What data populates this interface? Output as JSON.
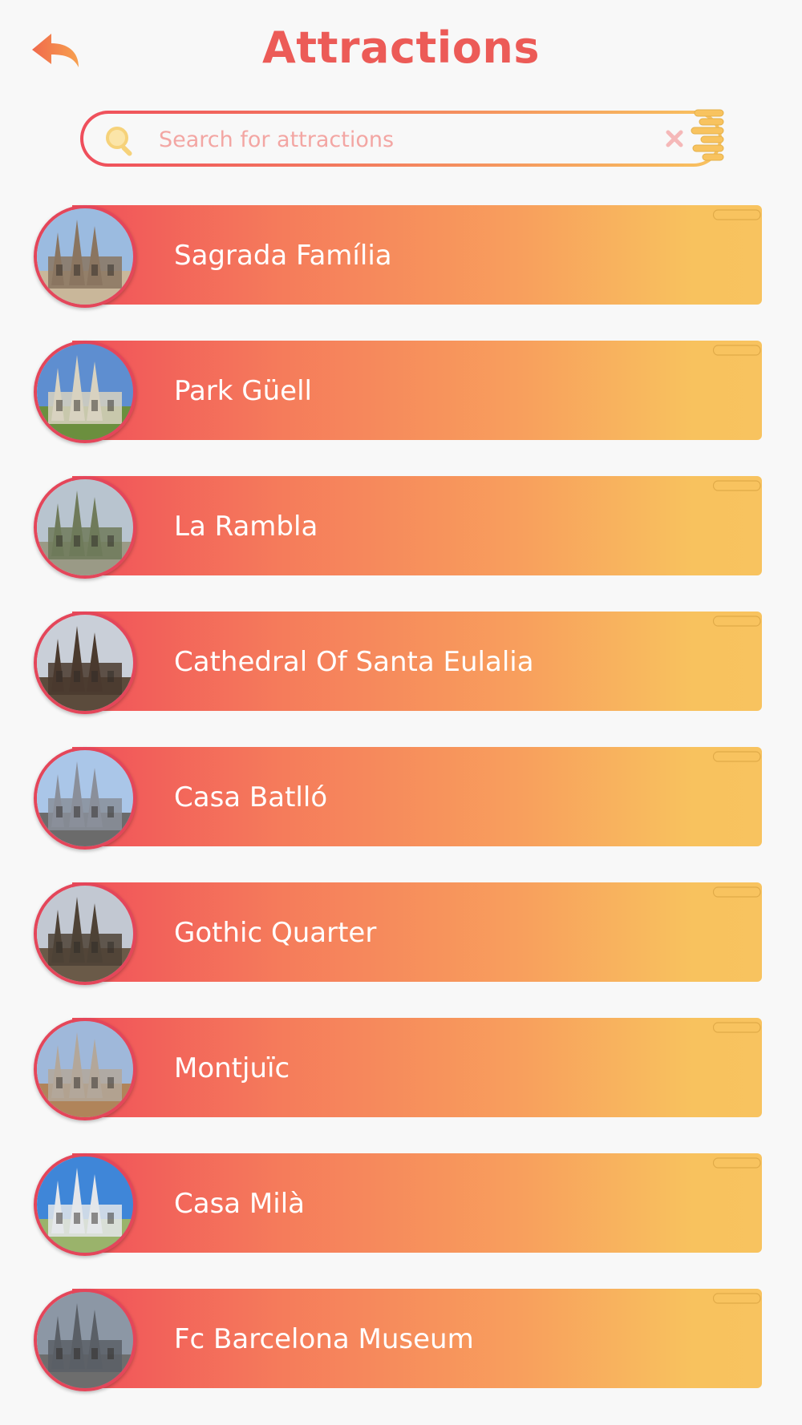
{
  "header": {
    "title": "Attractions",
    "back_icon": "back-arrow-icon"
  },
  "search": {
    "placeholder": "Search for attractions",
    "value": ""
  },
  "colors": {
    "accent": "#ec5b57",
    "gradient_start": "#f0505a",
    "gradient_end": "#f8c35f",
    "back_arrow": "#f47d4f"
  },
  "attractions": [
    {
      "label": "Sagrada Família",
      "image": "sagrada-familia-photo"
    },
    {
      "label": "Park Güell",
      "image": "park-guell-photo"
    },
    {
      "label": "La Rambla",
      "image": "la-rambla-photo"
    },
    {
      "label": "Cathedral Of Santa Eulalia",
      "image": "cathedral-photo"
    },
    {
      "label": "Casa Batlló",
      "image": "casa-batllo-photo"
    },
    {
      "label": "Gothic Quarter",
      "image": "gothic-quarter-photo"
    },
    {
      "label": "Montjuïc",
      "image": "montjuic-photo"
    },
    {
      "label": "Casa Milà",
      "image": "casa-mila-photo"
    },
    {
      "label": "Fc Barcelona Museum",
      "image": "fc-barcelona-museum-photo"
    }
  ]
}
